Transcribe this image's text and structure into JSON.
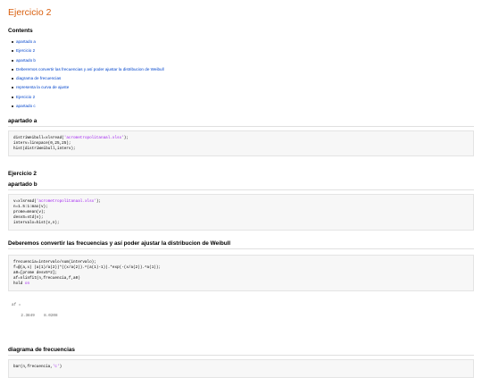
{
  "title": "Ejercicio 2",
  "contents_heading": "Contents",
  "toc": [
    "apartado a",
    "Ejercicio 2",
    "apartado b",
    "Deberemos convertir las frecuencias y así poder ajustar la distribucion de Weibull",
    "diagrama de frecuencias",
    "representa la curva de ajuste",
    "Ejercicio 2",
    "apartado c"
  ],
  "sections": {
    "apartado_a": {
      "heading": "apartado a",
      "code_lines": [
        "distriWeibull=xlsread('acrometropolitanaal.xlsx');",
        "interv=linspace(0,25,25);",
        "hist(distriWeibull,interv);"
      ]
    },
    "ejercicio2": {
      "heading": "Ejercicio 2"
    },
    "apartado_b": {
      "heading": "apartado b",
      "code_lines": [
        "v=xlsread('acrometropolitanaal.xlsx');",
        "n=1.5:1:max(v);",
        "prome=mean(v);",
        "desvS=std(v);",
        "intervalo=hist(v,n);"
      ]
    },
    "weibull": {
      "heading": "Deberemos convertir las frecuencias y así poder ajustar la distribucion de Weibull",
      "code_lines": [
        "frecuencia=intervalo/sum(intervalo);",
        "f=@(a,x) (a(1)/a(2))*((x/a(2)).^(a(1)-1)).*exp(-(x/a(2)).^a(1));",
        "a0=[prome desvS^2];",
        "af=nlinfit(n,frecuencia,f,a0)",
        "hold on"
      ],
      "output_lines": [
        "af =",
        "",
        "    2.3849    8.0208"
      ]
    },
    "diagrama": {
      "heading": "diagrama de frecuencias",
      "code_lines": [
        "bar(n,frecuencia,'c')"
      ]
    }
  }
}
